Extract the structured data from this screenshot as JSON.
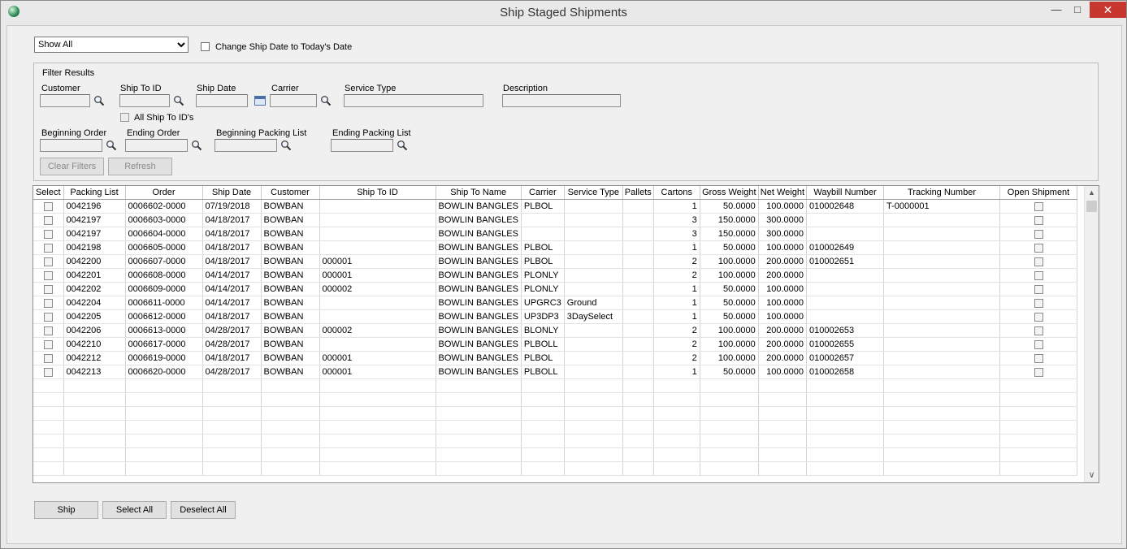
{
  "window": {
    "title": "Ship Staged Shipments",
    "min_glyph": "—",
    "max_glyph": "□",
    "close_glyph": "✕"
  },
  "top": {
    "show_select": "Show All",
    "change_date_label": "Change Ship Date to Today's Date"
  },
  "filter": {
    "group_label": "Filter Results",
    "customer_label": "Customer",
    "ship_to_id_label": "Ship To ID",
    "ship_date_label": "Ship Date",
    "carrier_label": "Carrier",
    "service_type_label": "Service Type",
    "description_label": "Description",
    "all_ship_to_label": "All Ship To ID's",
    "beginning_order_label": "Beginning Order",
    "ending_order_label": "Ending Order",
    "beginning_packing_list_label": "Beginning Packing List",
    "ending_packing_list_label": "Ending Packing List",
    "clear_filters_label": "Clear Filters",
    "refresh_label": "Refresh"
  },
  "grid": {
    "columns": [
      "Select",
      "Packing List",
      "Order",
      "Ship Date",
      "Customer",
      "Ship To ID",
      "Ship To Name",
      "Carrier",
      "Service Type",
      "Pallets",
      "Cartons",
      "Gross Weight",
      "Net Weight",
      "Waybill Number",
      "Tracking Number",
      "Open Shipment"
    ],
    "rows": [
      [
        "0042196",
        "0006602-0000",
        "07/19/2018",
        "BOWBAN",
        "",
        "BOWLIN BANGLES",
        "PLBOL",
        "",
        "",
        "1",
        "50.0000",
        "100.0000",
        "010002648",
        "T-0000001"
      ],
      [
        "0042197",
        "0006603-0000",
        "04/18/2017",
        "BOWBAN",
        "",
        "BOWLIN BANGLES",
        "",
        "",
        "",
        "3",
        "150.0000",
        "300.0000",
        "",
        ""
      ],
      [
        "0042197",
        "0006604-0000",
        "04/18/2017",
        "BOWBAN",
        "",
        "BOWLIN BANGLES",
        "",
        "",
        "",
        "3",
        "150.0000",
        "300.0000",
        "",
        ""
      ],
      [
        "0042198",
        "0006605-0000",
        "04/18/2017",
        "BOWBAN",
        "",
        "BOWLIN BANGLES",
        "PLBOL",
        "",
        "",
        "1",
        "50.0000",
        "100.0000",
        "010002649",
        ""
      ],
      [
        "0042200",
        "0006607-0000",
        "04/18/2017",
        "BOWBAN",
        "000001",
        "BOWLIN BANGLES",
        "PLBOL",
        "",
        "",
        "2",
        "100.0000",
        "200.0000",
        "010002651",
        ""
      ],
      [
        "0042201",
        "0006608-0000",
        "04/14/2017",
        "BOWBAN",
        "000001",
        "BOWLIN BANGLES",
        "PLONLY",
        "",
        "",
        "2",
        "100.0000",
        "200.0000",
        "",
        ""
      ],
      [
        "0042202",
        "0006609-0000",
        "04/14/2017",
        "BOWBAN",
        "000002",
        "BOWLIN BANGLES",
        "PLONLY",
        "",
        "",
        "1",
        "50.0000",
        "100.0000",
        "",
        ""
      ],
      [
        "0042204",
        "0006611-0000",
        "04/14/2017",
        "BOWBAN",
        "",
        "BOWLIN BANGLES",
        "UPGRC3",
        "Ground",
        "",
        "1",
        "50.0000",
        "100.0000",
        "",
        ""
      ],
      [
        "0042205",
        "0006612-0000",
        "04/18/2017",
        "BOWBAN",
        "",
        "BOWLIN BANGLES",
        "UP3DP3",
        "3DaySelect",
        "",
        "1",
        "50.0000",
        "100.0000",
        "",
        ""
      ],
      [
        "0042206",
        "0006613-0000",
        "04/28/2017",
        "BOWBAN",
        "000002",
        "BOWLIN BANGLES",
        "BLONLY",
        "",
        "",
        "2",
        "100.0000",
        "200.0000",
        "010002653",
        ""
      ],
      [
        "0042210",
        "0006617-0000",
        "04/28/2017",
        "BOWBAN",
        "",
        "BOWLIN BANGLES",
        "PLBOLL",
        "",
        "",
        "2",
        "100.0000",
        "200.0000",
        "010002655",
        ""
      ],
      [
        "0042212",
        "0006619-0000",
        "04/18/2017",
        "BOWBAN",
        "000001",
        "BOWLIN BANGLES",
        "PLBOL",
        "",
        "",
        "2",
        "100.0000",
        "200.0000",
        "010002657",
        ""
      ],
      [
        "0042213",
        "0006620-0000",
        "04/28/2017",
        "BOWBAN",
        "000001",
        "BOWLIN BANGLES",
        "PLBOLL",
        "",
        "",
        "1",
        "50.0000",
        "100.0000",
        "010002658",
        ""
      ]
    ],
    "empty_rows": 7,
    "scroll_up": "▲",
    "scroll_down": "∨"
  },
  "bottom": {
    "ship_label": "Ship",
    "select_all_label": "Select All",
    "deselect_all_label": "Deselect All"
  }
}
